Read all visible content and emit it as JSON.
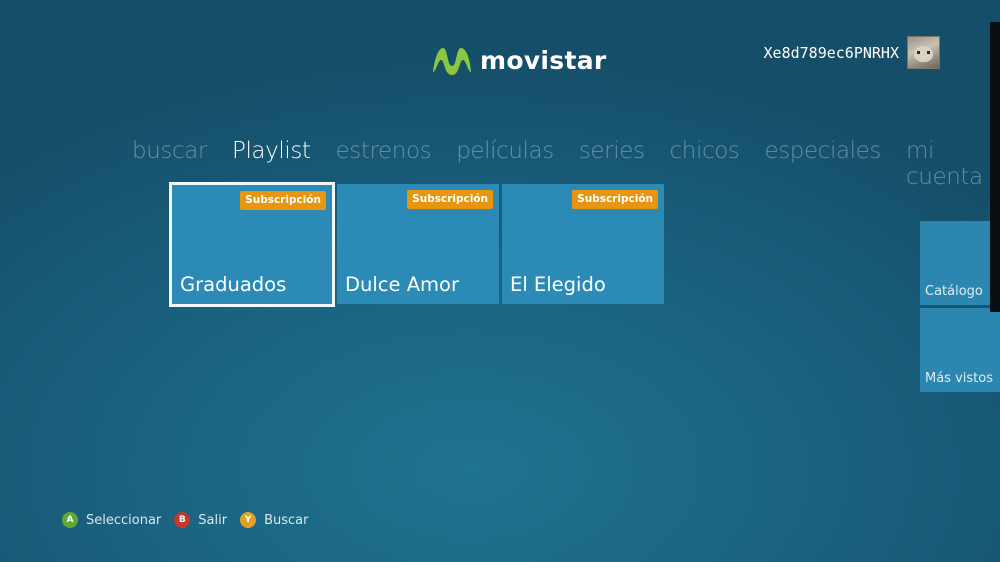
{
  "brand": {
    "name": "movistar",
    "color": "#8cc63f"
  },
  "user": {
    "gamertag": "Xe8d789ec6PNRHX"
  },
  "nav": {
    "items": [
      "buscar",
      "Playlist",
      "estrenos",
      "películas",
      "series",
      "chicos",
      "especiales",
      "mi cuenta"
    ],
    "active": "Playlist"
  },
  "tiles": [
    {
      "title": "Graduados",
      "badge": "Subscripción",
      "selected": true
    },
    {
      "title": "Dulce Amor",
      "badge": "Subscripción",
      "selected": false
    },
    {
      "title": "El Elegido",
      "badge": "Subscripción",
      "selected": false
    }
  ],
  "side_tiles": [
    {
      "label": "Catálogo"
    },
    {
      "label": "Más vistos"
    }
  ],
  "hints": [
    {
      "key": "A",
      "label": "Seleccionar",
      "color": "#5da933"
    },
    {
      "key": "B",
      "label": "Salir",
      "color": "#c0392b"
    },
    {
      "key": "Y",
      "label": "Buscar",
      "color": "#e0a02a"
    }
  ],
  "colors": {
    "accent_badge": "#e8960f",
    "tile": "#2b8bb6"
  }
}
